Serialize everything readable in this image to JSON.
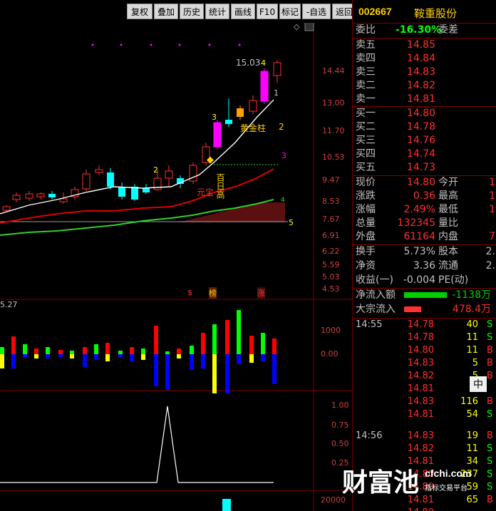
{
  "toolbar": {
    "buttons": [
      "复权",
      "叠加",
      "历史",
      "统计",
      "画线",
      "F10",
      "标记",
      "-自选",
      "返回"
    ]
  },
  "chart": {
    "price_axis": [
      "14.44",
      "13.00",
      "11.70",
      "10.53",
      "9.47",
      "8.53",
      "7.67",
      "6.91",
      "6.22",
      "5.59",
      "5.03",
      "4.53"
    ],
    "vol_axis": [
      "1000",
      "0.00"
    ],
    "ind_axis": [
      "1.00",
      "0.75",
      "0.50",
      "0.25"
    ],
    "bottom_axis": "20000",
    "high_label": "15.03",
    "sub_label_left": "5.27",
    "annotations": {
      "gold_pillar": "黄金柱",
      "gold_num": "2",
      "yuan_bao": "元宝",
      "bai_ri_gao": "百日高",
      "marker_3a": "3",
      "marker_3b": "3",
      "marker_2": "2",
      "marker_4": "4",
      "marker_1": "1",
      "ma_label_4": "4",
      "ma_label_5": "5",
      "ma_label_3": "3",
      "icon_s": "$",
      "icon_bang": "榜",
      "icon_zhang": "涨"
    },
    "colors": {
      "up": "#ff3030",
      "down": "#00ffff",
      "ma_white": "#ffffff",
      "ma_red": "#e00000",
      "ma_green": "#30d030",
      "magenta": "#ff00ff",
      "yellow": "#ffff00"
    }
  },
  "panel": {
    "code": "002667",
    "name": "鞍重股份",
    "webi_label": "委比",
    "webi_value": "-16.30%",
    "weicha_label": "委差",
    "sell": [
      {
        "label": "卖五",
        "price": "14.85"
      },
      {
        "label": "卖四",
        "price": "14.84"
      },
      {
        "label": "卖三",
        "price": "14.83"
      },
      {
        "label": "卖二",
        "price": "14.82"
      },
      {
        "label": "卖一",
        "price": "14.81"
      }
    ],
    "buy": [
      {
        "label": "买一",
        "price": "14.80"
      },
      {
        "label": "买二",
        "price": "14.78"
      },
      {
        "label": "买三",
        "price": "14.76"
      },
      {
        "label": "买四",
        "price": "14.74"
      },
      {
        "label": "买五",
        "price": "14.73"
      }
    ],
    "stats": [
      {
        "l1": "现价",
        "v1": "14.80",
        "l2": "今开",
        "v2": "1"
      },
      {
        "l1": "涨跌",
        "v1": "0.36",
        "l2": "最高",
        "v2": "1"
      },
      {
        "l1": "涨幅",
        "v1": "2.49%",
        "l2": "最低",
        "v2": "1"
      },
      {
        "l1": "总量",
        "v1": "132345",
        "l2": "量比",
        "v2": ""
      },
      {
        "l1": "外盘",
        "v1": "61164",
        "l2": "内盘",
        "v2": "7"
      }
    ],
    "stats2": [
      {
        "l1": "换手",
        "v1": "5.73%",
        "l2": "股本",
        "v2": "2."
      },
      {
        "l1": "净资",
        "v1": "3.36",
        "l2": "流通",
        "v2": "2."
      },
      {
        "l1": "收益(一)",
        "v1": "-0.004",
        "l2": "PE(动)",
        "v2": ""
      }
    ],
    "flow": [
      {
        "label": "净流入额",
        "value": "-1138万",
        "color": "#00d000",
        "bar": 0.75
      },
      {
        "label": "大宗流入",
        "value": "478.4万",
        "color": "#ff3030",
        "bar": 0.3
      }
    ],
    "ticks": [
      {
        "time": "14:55",
        "price": "14.78",
        "vol": "40",
        "bs": "S"
      },
      {
        "time": "",
        "price": "14.78",
        "vol": "11",
        "bs": "S"
      },
      {
        "time": "",
        "price": "14.80",
        "vol": "11",
        "bs": "B"
      },
      {
        "time": "",
        "price": "14.83",
        "vol": "5",
        "bs": "B"
      },
      {
        "time": "",
        "price": "14.82",
        "vol": "5",
        "bs": "B"
      },
      {
        "time": "",
        "price": "14.81",
        "vol": "",
        "bs": ""
      },
      {
        "time": "",
        "price": "14.83",
        "vol": "116",
        "bs": "B"
      },
      {
        "time": "",
        "price": "14.81",
        "vol": "54",
        "bs": "S"
      },
      {
        "time": "14:56",
        "price": "14.83",
        "vol": "19",
        "bs": "B"
      },
      {
        "time": "",
        "price": "14.82",
        "vol": "11",
        "bs": "S"
      },
      {
        "time": "",
        "price": "14.81",
        "vol": "34",
        "bs": "S"
      },
      {
        "time": "",
        "price": "14.80",
        "vol": "237",
        "bs": "S"
      },
      {
        "time": "",
        "price": "14.80",
        "vol": "59",
        "bs": "S"
      },
      {
        "time": "",
        "price": "14.81",
        "vol": "65",
        "bs": "B"
      },
      {
        "time": "",
        "price": "14.80",
        "vol": "",
        "bs": ""
      }
    ],
    "ime_label": "中"
  },
  "watermark": {
    "brand": "财富池",
    "domain": "cfchi.com",
    "slogan": "指标交易平台"
  }
}
